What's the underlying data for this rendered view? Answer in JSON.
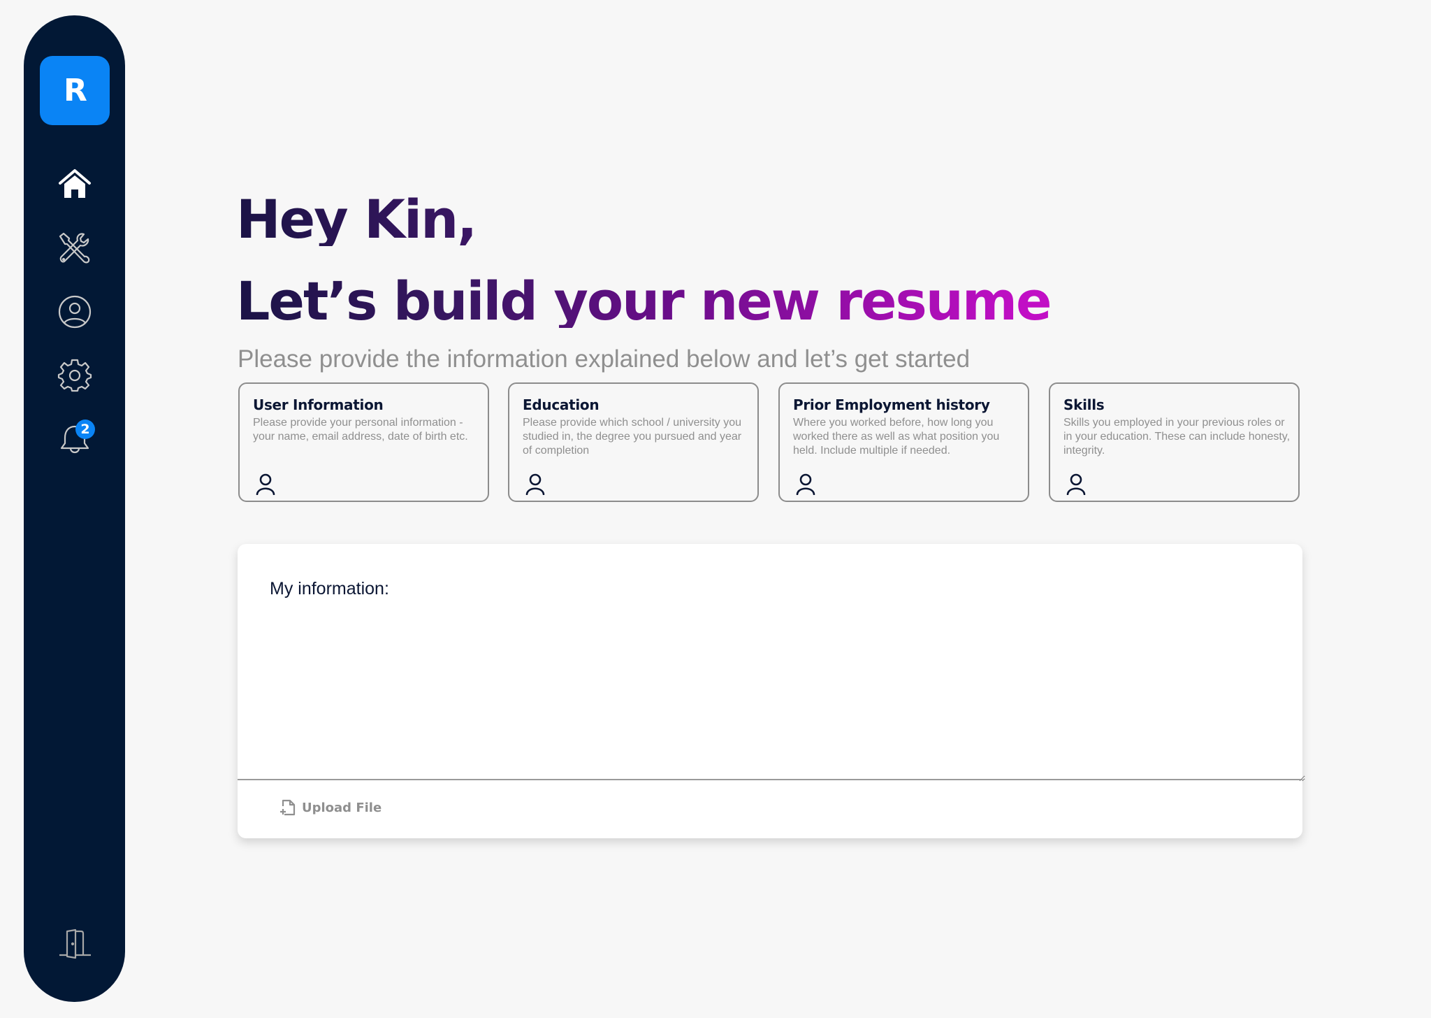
{
  "sidebar": {
    "logo": "R",
    "items": [
      {
        "name": "home",
        "icon": "home-icon",
        "active": true
      },
      {
        "name": "tools",
        "icon": "tools-icon"
      },
      {
        "name": "profile",
        "icon": "user-circle-icon"
      },
      {
        "name": "settings",
        "icon": "gear-icon"
      },
      {
        "name": "notifications",
        "icon": "bell-icon",
        "badge": "2"
      }
    ],
    "logout_icon": "door-icon"
  },
  "header": {
    "greeting": "Hey Kin,",
    "title": "Let’s build your new resume",
    "subtitle": "Please provide the information explained below and let’s get started"
  },
  "cards": [
    {
      "title": "User Information",
      "description": "Please provide your personal information - your name, email address, date of birth etc.",
      "icon": "user-icon"
    },
    {
      "title": "Education",
      "description": "Please provide which school / university you studied in, the degree you pursued and year of completion",
      "icon": "user-icon"
    },
    {
      "title": "Prior Employment history",
      "description": "Where you worked before, how long you worked there as well as what position you held. Include multiple if needed.",
      "icon": "user-icon"
    },
    {
      "title": "Skills",
      "description": "Skills you employed in your previous roles or in your education. These can include honesty, integrity.",
      "icon": "user-icon"
    }
  ],
  "info_panel": {
    "label": "My information:",
    "value": "",
    "upload_label": "Upload File"
  },
  "colors": {
    "sidebar_bg": "#021835",
    "accent": "#0a84f5",
    "heading_gradient_start": "#1b1346",
    "heading_gradient_end": "#c10fc5"
  }
}
